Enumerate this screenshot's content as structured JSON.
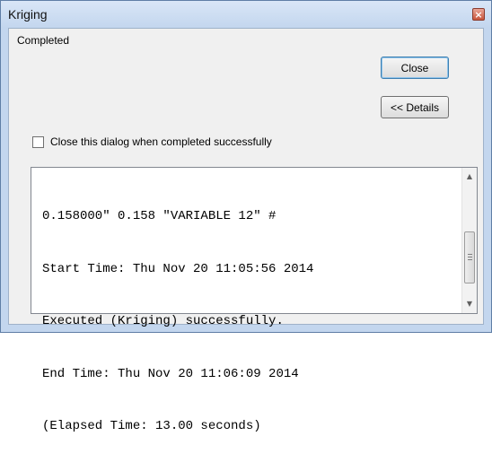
{
  "window": {
    "title": "Kriging",
    "close_glyph": "×"
  },
  "status": {
    "text": "Completed"
  },
  "buttons": {
    "close_label": "Close",
    "details_label": "<< Details"
  },
  "checkbox": {
    "label": "Close this dialog when completed successfully",
    "checked": false
  },
  "log": {
    "lines": [
      "0.158000\" 0.158 \"VARIABLE 12\" #",
      "Start Time: Thu Nov 20 11:05:56 2014",
      "Executed (Kriging) successfully.",
      "End Time: Thu Nov 20 11:06:09 2014",
      "(Elapsed Time: 13.00 seconds)"
    ]
  },
  "scrollbar": {
    "up_glyph": "▲",
    "down_glyph": "▼"
  }
}
